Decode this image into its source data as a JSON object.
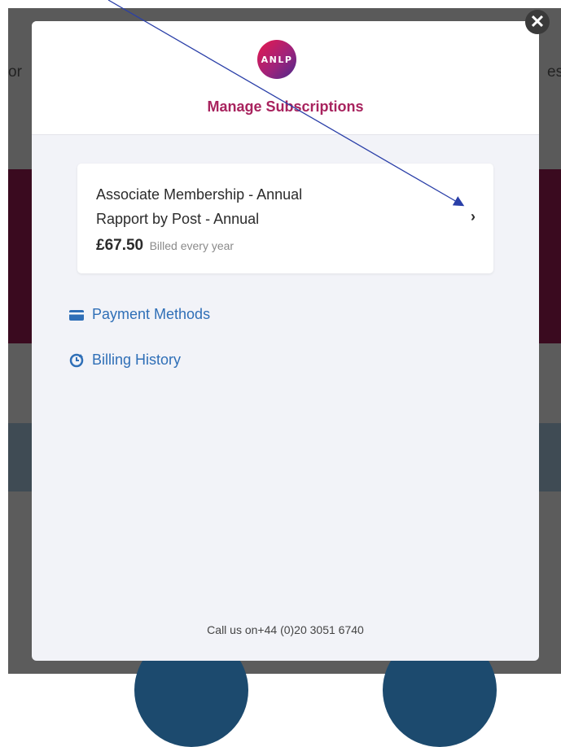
{
  "background": {
    "text_left": "or",
    "text_right": "es"
  },
  "close": {
    "label": "✕",
    "icon": "close-icon"
  },
  "modal": {
    "logo_text": "ANLP",
    "title": "Manage Subscriptions",
    "subscription": {
      "line1": "Associate Membership - Annual",
      "line2": "Rapport by Post - Annual",
      "price": "£67.50",
      "billing": "Billed every year",
      "chevron": "›"
    },
    "links": {
      "payment_methods": "Payment Methods",
      "billing_history": "Billing History"
    },
    "footer": "Call us on+44 (0)20 3051 6740"
  },
  "colors": {
    "accent": "#a8235e",
    "link": "#2f6fb7",
    "annotation_arrow": "#2a3fa8"
  }
}
